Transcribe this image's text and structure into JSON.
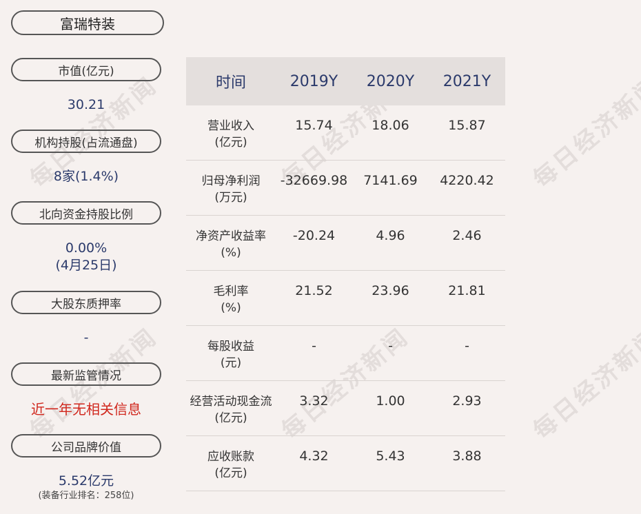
{
  "watermark": "每日经济新闻",
  "company": "富瑞特装",
  "left_panel": [
    {
      "label": "市值(亿元)",
      "value": "30.21"
    },
    {
      "label": "机构持股(占流通盘)",
      "value": "8家(1.4%)"
    },
    {
      "label": "北向资金持股比例",
      "value": "0.00%",
      "value2": "(4月25日)"
    },
    {
      "label": "大股东质押率",
      "value": "-"
    },
    {
      "label": "最新监管情况",
      "value": "近一年无相关信息"
    },
    {
      "label": "公司品牌价值",
      "value": "5.52亿元",
      "note": "(装备行业排名：258位)"
    }
  ],
  "table": {
    "headers": [
      "时间",
      "2019Y",
      "2020Y",
      "2021Y"
    ],
    "rows": [
      {
        "label": "营业收入",
        "unit": "(亿元)",
        "values": [
          "15.74",
          "18.06",
          "15.87"
        ]
      },
      {
        "label": "归母净利润",
        "unit": "(万元)",
        "values": [
          "-32669.98",
          "7141.69",
          "4220.42"
        ]
      },
      {
        "label": "净资产收益率",
        "unit": "(%)",
        "values": [
          "-20.24",
          "4.96",
          "2.46"
        ]
      },
      {
        "label": "毛利率",
        "unit": "(%)",
        "values": [
          "21.52",
          "23.96",
          "21.81"
        ]
      },
      {
        "label": "每股收益",
        "unit": "(元)",
        "values": [
          "-",
          "-",
          "-"
        ]
      },
      {
        "label": "经营活动现金流",
        "unit": "(亿元)",
        "values": [
          "3.32",
          "1.00",
          "2.93"
        ]
      },
      {
        "label": "应收账款",
        "unit": "(亿元)",
        "values": [
          "4.32",
          "5.43",
          "3.88"
        ]
      }
    ]
  },
  "colors": {
    "accent": "#2b3a6b",
    "alert": "#d0271d",
    "header_bg": "#e4dfdd",
    "page_bg": "#f6f1ef"
  }
}
